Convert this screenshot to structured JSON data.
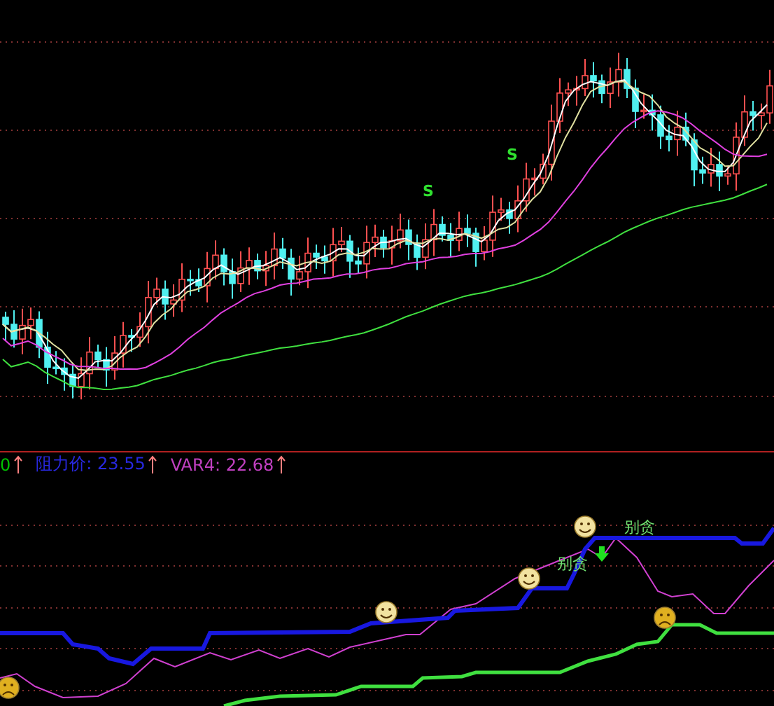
{
  "price_panel": {
    "signals": [
      {
        "text": "S"
      },
      {
        "text": "S"
      }
    ]
  },
  "legend": [
    {
      "text": "0",
      "color": "#00c000"
    },
    {
      "text": "阻力价: 23.55",
      "color": "#2828e0"
    },
    {
      "text": "VAR4: 22.68",
      "color": "#c040c0"
    }
  ],
  "indicator_panel": {
    "labels": [
      {
        "text": "别贪"
      },
      {
        "text": "别贪"
      }
    ],
    "markers": [
      {
        "kind": "sad"
      },
      {
        "kind": "smile"
      },
      {
        "kind": "smile"
      },
      {
        "kind": "smile"
      },
      {
        "kind": "sad"
      }
    ]
  }
}
